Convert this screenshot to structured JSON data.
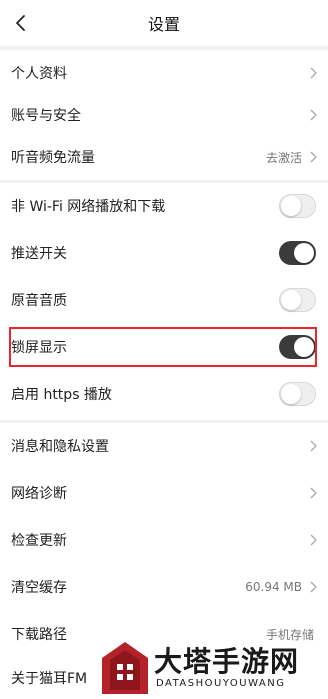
{
  "header": {
    "title": "设置"
  },
  "groups": [
    {
      "items": [
        {
          "label": "个人资料",
          "type": "chevron"
        },
        {
          "label": "账号与安全",
          "type": "chevron"
        },
        {
          "label": "听音频免流量",
          "type": "chevron",
          "value": "去激活"
        }
      ]
    },
    {
      "items": [
        {
          "label": "非 Wi-Fi 网络播放和下载",
          "type": "toggle",
          "on": false
        },
        {
          "label": "推送开关",
          "type": "toggle",
          "on": true
        },
        {
          "label": "原音音质",
          "type": "toggle",
          "on": false
        },
        {
          "label": "锁屏显示",
          "type": "toggle",
          "on": true
        },
        {
          "label": "启用 https 播放",
          "type": "toggle",
          "on": false
        }
      ]
    },
    {
      "items": [
        {
          "label": "消息和隐私设置",
          "type": "chevron"
        },
        {
          "label": "网络诊断",
          "type": "chevron"
        },
        {
          "label": "检查更新",
          "type": "chevron"
        },
        {
          "label": "清空缓存",
          "type": "chevron",
          "value": "60.94 MB"
        },
        {
          "label": "下载路径",
          "type": "value",
          "value": "手机存储"
        },
        {
          "label": "关于猫耳FM",
          "type": "value"
        }
      ]
    }
  ],
  "watermark": {
    "title": "大塔手游网",
    "subtitle": "DATASHOUYOUWANG"
  },
  "colors": {
    "highlight": "#e8262d",
    "toggle_on": "#3b3b3b",
    "toggle_off": "#efefef"
  }
}
